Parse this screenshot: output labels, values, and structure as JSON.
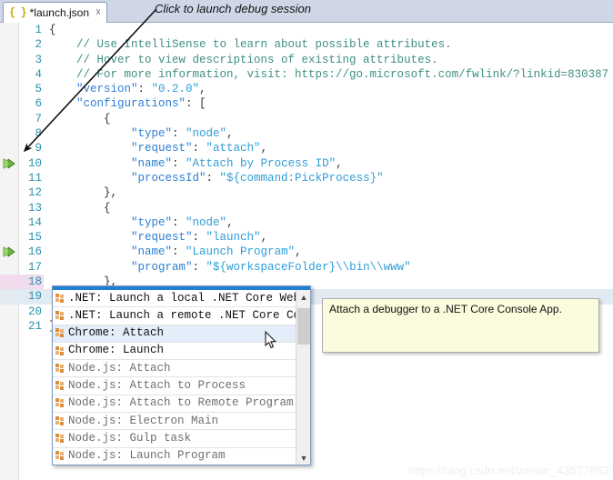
{
  "tab": {
    "icon": "json-braces-icon",
    "label": "*launch.json",
    "close_icon": "close-icon"
  },
  "annotation": {
    "text": "Click to launch debug session"
  },
  "editor": {
    "lines": [
      {
        "no": "1",
        "text": "{",
        "modified": false,
        "current": false,
        "run_marker": false
      },
      {
        "no": "2",
        "text": "    // Use IntelliSense to learn about possible attributes.",
        "modified": false,
        "current": false,
        "run_marker": false
      },
      {
        "no": "3",
        "text": "    // Hover to view descriptions of existing attributes.",
        "modified": false,
        "current": false,
        "run_marker": false
      },
      {
        "no": "4",
        "text": "    // For more information, visit: https://go.microsoft.com/fwlink/?linkid=830387",
        "modified": false,
        "current": false,
        "run_marker": false
      },
      {
        "no": "5",
        "text": "    \"version\": \"0.2.0\",",
        "modified": false,
        "current": false,
        "run_marker": false
      },
      {
        "no": "6",
        "text": "    \"configurations\": [",
        "modified": false,
        "current": false,
        "run_marker": false
      },
      {
        "no": "7",
        "text": "        {",
        "modified": false,
        "current": false,
        "run_marker": false
      },
      {
        "no": "8",
        "text": "            \"type\": \"node\",",
        "modified": false,
        "current": false,
        "run_marker": false
      },
      {
        "no": "9",
        "text": "            \"request\": \"attach\",",
        "modified": false,
        "current": false,
        "run_marker": false
      },
      {
        "no": "10",
        "text": "            \"name\": \"Attach by Process ID\",",
        "modified": false,
        "current": false,
        "run_marker": true
      },
      {
        "no": "11",
        "text": "            \"processId\": \"${command:PickProcess}\"",
        "modified": false,
        "current": false,
        "run_marker": false
      },
      {
        "no": "12",
        "text": "        },",
        "modified": false,
        "current": false,
        "run_marker": false
      },
      {
        "no": "13",
        "text": "        {",
        "modified": false,
        "current": false,
        "run_marker": false
      },
      {
        "no": "14",
        "text": "            \"type\": \"node\",",
        "modified": false,
        "current": false,
        "run_marker": false
      },
      {
        "no": "15",
        "text": "            \"request\": \"launch\",",
        "modified": false,
        "current": false,
        "run_marker": false
      },
      {
        "no": "16",
        "text": "            \"name\": \"Launch Program\",",
        "modified": false,
        "current": false,
        "run_marker": true
      },
      {
        "no": "17",
        "text": "            \"program\": \"${workspaceFolder}\\\\bin\\\\www\"",
        "modified": false,
        "current": false,
        "run_marker": false
      },
      {
        "no": "18",
        "text": "        },",
        "modified": true,
        "current": false,
        "run_marker": false
      },
      {
        "no": "19",
        "text": "",
        "modified": false,
        "current": true,
        "run_marker": false
      },
      {
        "no": "20",
        "text": "",
        "modified": false,
        "current": false,
        "run_marker": false
      },
      {
        "no": "21",
        "text": "}",
        "modified": false,
        "current": false,
        "run_marker": false
      }
    ]
  },
  "autocomplete": {
    "selected_index": 2,
    "items": [
      {
        "label": ".NET: Launch a local .NET Core Web A",
        "dim": false
      },
      {
        "label": ".NET: Launch a remote .NET Core Cons",
        "dim": false
      },
      {
        "label": "Chrome: Attach",
        "dim": false
      },
      {
        "label": "Chrome: Launch",
        "dim": false
      },
      {
        "label": "Node.js: Attach",
        "dim": true
      },
      {
        "label": "Node.js: Attach to Process",
        "dim": true
      },
      {
        "label": "Node.js: Attach to Remote Program",
        "dim": true
      },
      {
        "label": "Node.js: Electron Main",
        "dim": true
      },
      {
        "label": "Node.js: Gulp task",
        "dim": true
      },
      {
        "label": "Node.js: Launch Program",
        "dim": true
      }
    ],
    "scroll_up_icon": "chevron-up-icon",
    "scroll_down_icon": "chevron-down-icon"
  },
  "tooltip": {
    "text": "Attach a debugger to a .NET Core Console App."
  },
  "watermark": {
    "text": "https://blog.csdn.net/weixin_43577863"
  },
  "colors": {
    "tabbar_bg": "#cfd6e6",
    "accent_blue": "#1f7fd0",
    "selection_bg": "#e4eefa",
    "tooltip_bg": "#fbfbdd",
    "current_line": "#e2eaf2",
    "modified_gutter": "#f0dcec",
    "run_marker_green": "#5aa832",
    "string_blue": "#2f9ed8",
    "comment_teal": "#3f8f84"
  }
}
